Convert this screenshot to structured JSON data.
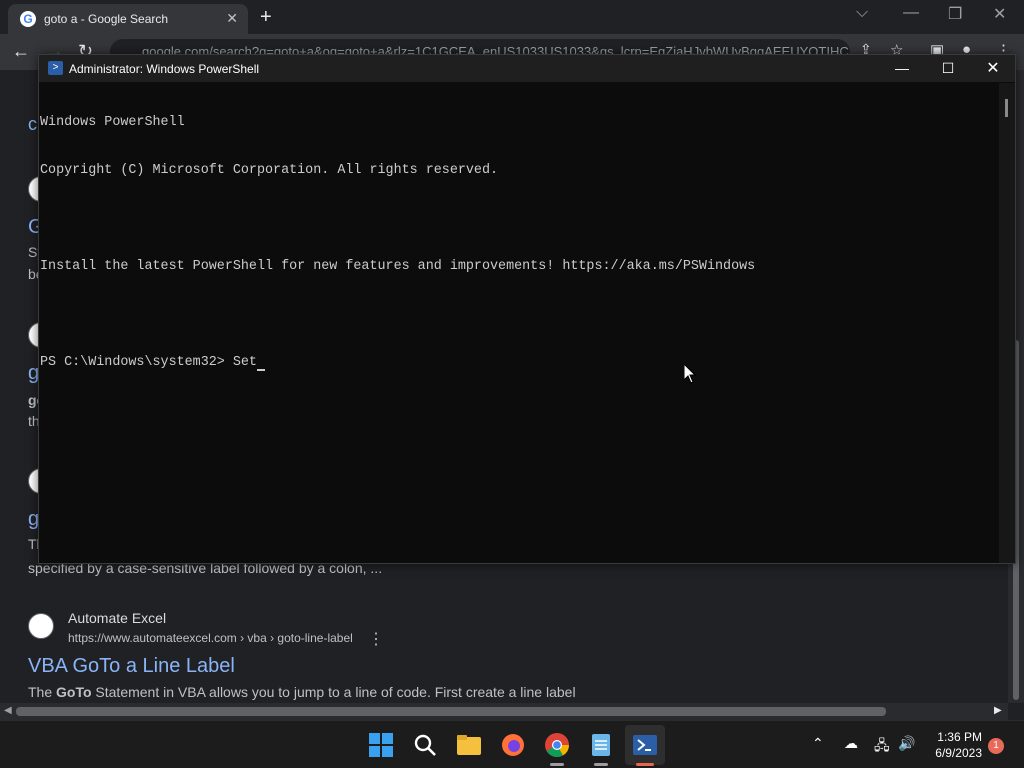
{
  "browser": {
    "tab_title": "goto a - Google Search",
    "address": "google.com/search?q=goto+a&oq=goto+a&rlz=1C1GCEA_enUS1033US1033&gs_lcrp=EgZjaHJvbWUyBggAEEUYOTIHCAEQABiABDIGCAIQABgKGL",
    "results": [
      {
        "site": "Automate Excel",
        "url": "https://www.automateexcel.com › vba › goto-line-label",
        "title": "VBA GoTo a Line Label",
        "snippet_bold": "GoTo",
        "snippet_pre": "The ",
        "snippet_post": " Statement in VBA allows you to jump to a line of code. First create a line label"
      }
    ],
    "partial_snippet": "specified by a case-sensitive label followed by a colon, ...",
    "edge_letters": [
      "c",
      "G",
      "Sy",
      "be",
      "g",
      "go",
      "th",
      "g",
      "Tl"
    ]
  },
  "powershell": {
    "title": "Administrator: Windows PowerShell",
    "lines": [
      "Windows PowerShell",
      "Copyright (C) Microsoft Corporation. All rights reserved.",
      "",
      "Install the latest PowerShell for new features and improvements! https://aka.ms/PSWindows",
      "",
      "PS C:\\Windows\\system32> Set"
    ]
  },
  "taskbar": {
    "time": "1:36 PM",
    "date": "6/9/2023",
    "notification_count": "1"
  },
  "colors": {
    "console_bg": "#0c0c0c",
    "console_fg": "#cccccc",
    "link": "#8ab4f8"
  }
}
